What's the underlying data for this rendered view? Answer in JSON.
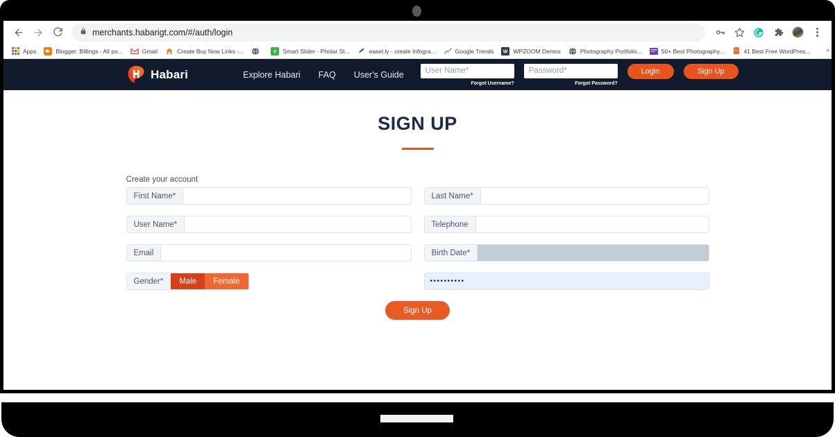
{
  "browser": {
    "back_icon": "back-arrow-icon",
    "forward_icon": "forward-arrow-icon",
    "reload_icon": "reload-icon",
    "url": "merchants.habarigt.com/#/auth/login",
    "lock_icon": "lock-icon",
    "toolbar_icons": [
      "password-key-icon",
      "bookmark-star-icon",
      "grammarly-icon",
      "extensions-puzzle-icon",
      "profile-avatar",
      "chrome-menu-icon"
    ],
    "overflow_label": "»"
  },
  "bookmarks": [
    {
      "label": "Apps",
      "icon": "apps-grid-icon",
      "color": "#34a853"
    },
    {
      "label": "Blogger: Billings - All po...",
      "icon": "blogger-icon",
      "color": "#f57c00"
    },
    {
      "label": "Gmail",
      "icon": "gmail-icon",
      "color": "#ea4335"
    },
    {
      "label": "Create Buy Now Links -...",
      "icon": "house-icon",
      "color": "#d98b3a"
    },
    {
      "label": "",
      "icon": "globe-icon",
      "color": "#5f6368"
    },
    {
      "label": "Smart Slider - Pholar St...",
      "icon": "smart-slider-icon",
      "color": "#39b54a"
    },
    {
      "label": "easel.ly - create Infogra...",
      "icon": "easelly-pen-icon",
      "color": "#2f6fb5"
    },
    {
      "label": "Google Trends",
      "icon": "trends-chart-icon",
      "color": "#4285f4"
    },
    {
      "label": "WPZOOM Demos",
      "icon": "wpzoom-icon",
      "color": "#2e3a4d"
    },
    {
      "label": "Photography Portfolio...",
      "icon": "globe-icon",
      "color": "#4b5560"
    },
    {
      "label": "50+ Best Photography...",
      "icon": "purple-square-icon",
      "color": "#6b44a8"
    },
    {
      "label": "41 Best Free WordPress...",
      "icon": "orange-badge-icon",
      "color": "#ef6c2e"
    }
  ],
  "site": {
    "brand_name": "Habari",
    "brand_logo_icon": "habari-logo-icon",
    "nav_links": [
      {
        "label": "Explore Habari"
      },
      {
        "label": "FAQ"
      },
      {
        "label": "User's Guide"
      }
    ],
    "login": {
      "username_placeholder": "User Name*",
      "username_value": "",
      "password_placeholder": "Password*",
      "password_value": "",
      "forgot_username": "Forgot Username?",
      "forgot_password": "Forgot Password?",
      "login_button": "Login",
      "signup_button": "Sign Up"
    },
    "accent_orange": "#e8541e",
    "nav_navy": "#121a2e"
  },
  "page": {
    "heading": "SIGN UP",
    "heading_color": "#1d2a4d",
    "rule_color": "#e8541e",
    "create_label": "Create your account",
    "fields": {
      "first_name": {
        "label": "First Name*",
        "value": ""
      },
      "last_name": {
        "label": "Last Name*",
        "value": ""
      },
      "user_name": {
        "label": "User Name*",
        "value": ""
      },
      "telephone": {
        "label": "Telephone",
        "value": ""
      },
      "email": {
        "label": "Email",
        "value": ""
      },
      "birth_date": {
        "label": "Birth Date*",
        "value": ""
      },
      "gender": {
        "label": "Gender*",
        "male": "Male",
        "female": "Female",
        "selected": "Male"
      },
      "password": {
        "label": "",
        "value": "••••••••••"
      }
    },
    "submit_button": "Sign Up"
  }
}
